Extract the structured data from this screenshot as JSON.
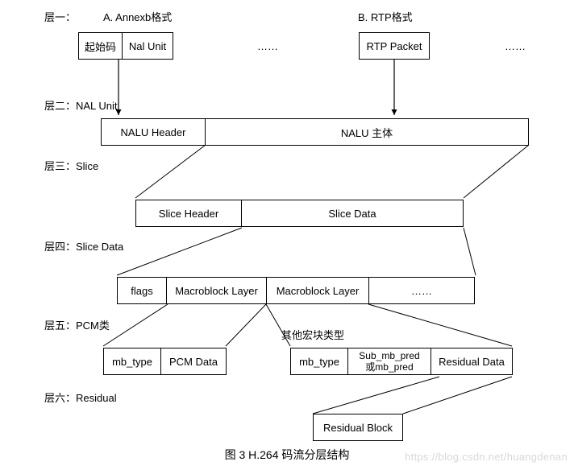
{
  "layer1": {
    "label": "层一：",
    "a_title": "A. Annexb格式",
    "b_title": "B. RTP格式",
    "start_code": "起始码",
    "nal_unit": "Nal Unit",
    "rtp_packet": "RTP Packet",
    "ellipsis_a": "……",
    "ellipsis_b": "……"
  },
  "layer2": {
    "label": "层二：NAL Unit",
    "nalu_header": "NALU Header",
    "nalu_body": "NALU 主体"
  },
  "layer3": {
    "label": "层三：Slice",
    "slice_header": "Slice Header",
    "slice_data": "Slice Data"
  },
  "layer4": {
    "label": "层四：Slice Data",
    "flags": "flags",
    "mb_layer1": "Macroblock Layer",
    "mb_layer2": "Macroblock Layer",
    "ellipsis": "……"
  },
  "layer5": {
    "label": "层五：PCM类",
    "other_mb": "其他宏块类型",
    "mb_type_l": "mb_type",
    "pcm_data": "PCM Data",
    "mb_type_r": "mb_type",
    "sub_mb": "Sub_mb_pred\n或mb_pred",
    "residual_data": "Residual Data"
  },
  "layer6": {
    "label": "层六：Residual",
    "residual_block": "Residual Block"
  },
  "caption": "图 3 H.264 码流分层结构",
  "watermark": "https://blog.csdn.net/huangdenan"
}
